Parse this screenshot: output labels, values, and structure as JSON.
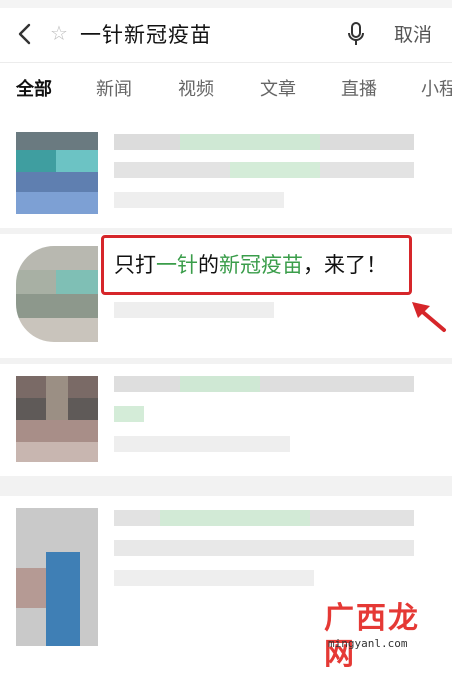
{
  "header": {
    "query": "一针新冠疫苗",
    "cancel_label": "取消",
    "icons": [
      "back-icon",
      "star-icon",
      "mic-icon"
    ]
  },
  "tabs": [
    {
      "label": "全部",
      "active": true
    },
    {
      "label": "新闻",
      "active": false
    },
    {
      "label": "视频",
      "active": false
    },
    {
      "label": "文章",
      "active": false
    },
    {
      "label": "直播",
      "active": false
    },
    {
      "label": "小程",
      "active": false
    }
  ],
  "highlight": {
    "part1": "只打",
    "part2": "一针",
    "part3": "的",
    "part4": "新冠疫苗",
    "part5": "，来了！"
  },
  "watermark": {
    "title": "广西龙网",
    "url": "mingyanl.com"
  },
  "colors": {
    "highlight_border": "#d6262a",
    "keyword_green": "#3a9d4a",
    "watermark_red": "#e53935"
  }
}
